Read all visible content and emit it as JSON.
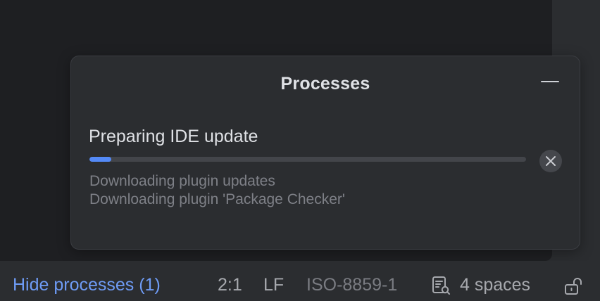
{
  "popup": {
    "title": "Processes",
    "task": {
      "title": "Preparing IDE update",
      "progress": 0.05,
      "details": [
        "Downloading plugin updates",
        "Downloading plugin 'Package Checker'"
      ]
    }
  },
  "status_bar": {
    "hide_processes": "Hide processes (1)",
    "caret_position": "2:1",
    "line_separator": "LF",
    "encoding": "ISO-8859-1",
    "indent": "4 spaces"
  },
  "icons": {
    "minimize": "minimize-icon",
    "cancel": "close-icon",
    "indent": "document-settings-icon",
    "lock": "unlock-icon"
  },
  "colors": {
    "accent": "#548af7",
    "link": "#6e9bf5",
    "popup_bg": "#2b2d30",
    "editor_bg": "#1e1f22"
  }
}
